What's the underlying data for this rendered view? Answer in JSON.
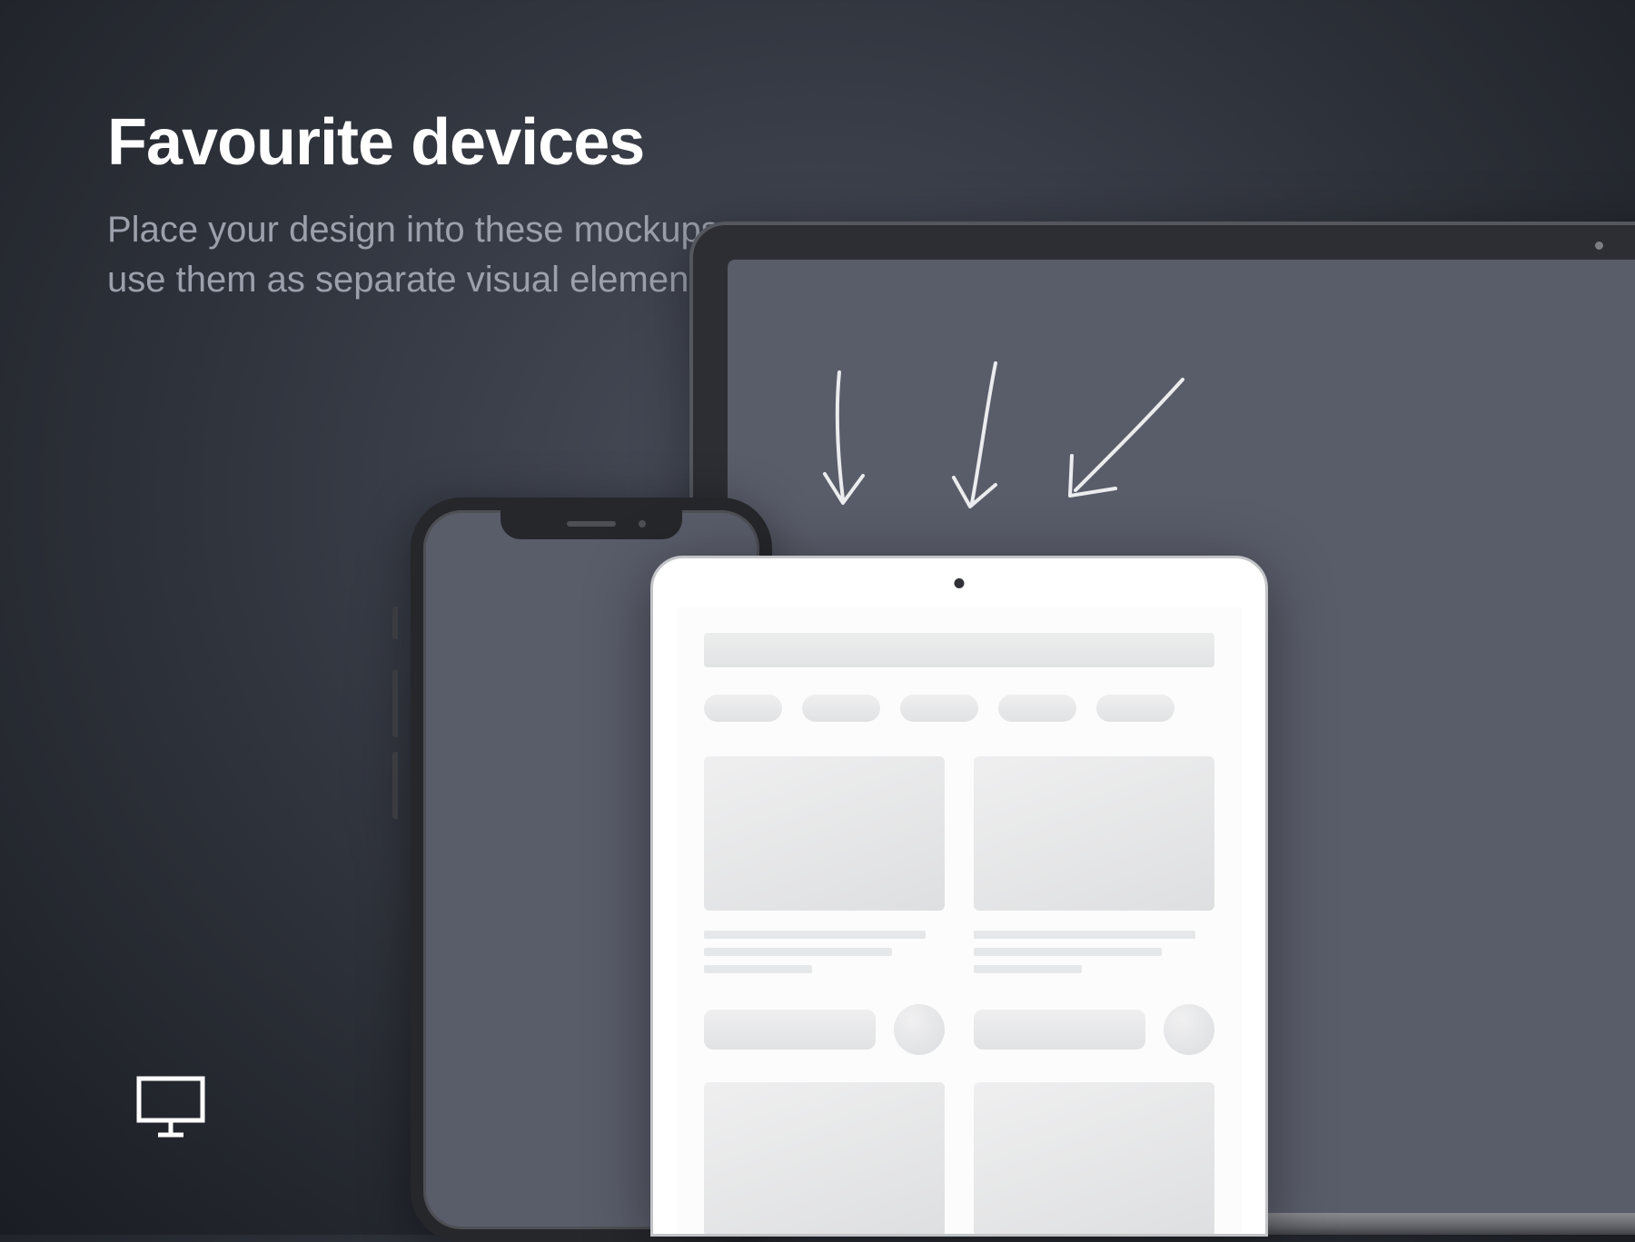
{
  "heading": "Favourite devices",
  "subheading": "Place your design into these mockups or use them as separate visual elements",
  "icons": {
    "monitor": "monitor-icon",
    "arrows": "hand-drawn-arrows"
  },
  "devices": [
    "phone",
    "tablet",
    "laptop"
  ]
}
